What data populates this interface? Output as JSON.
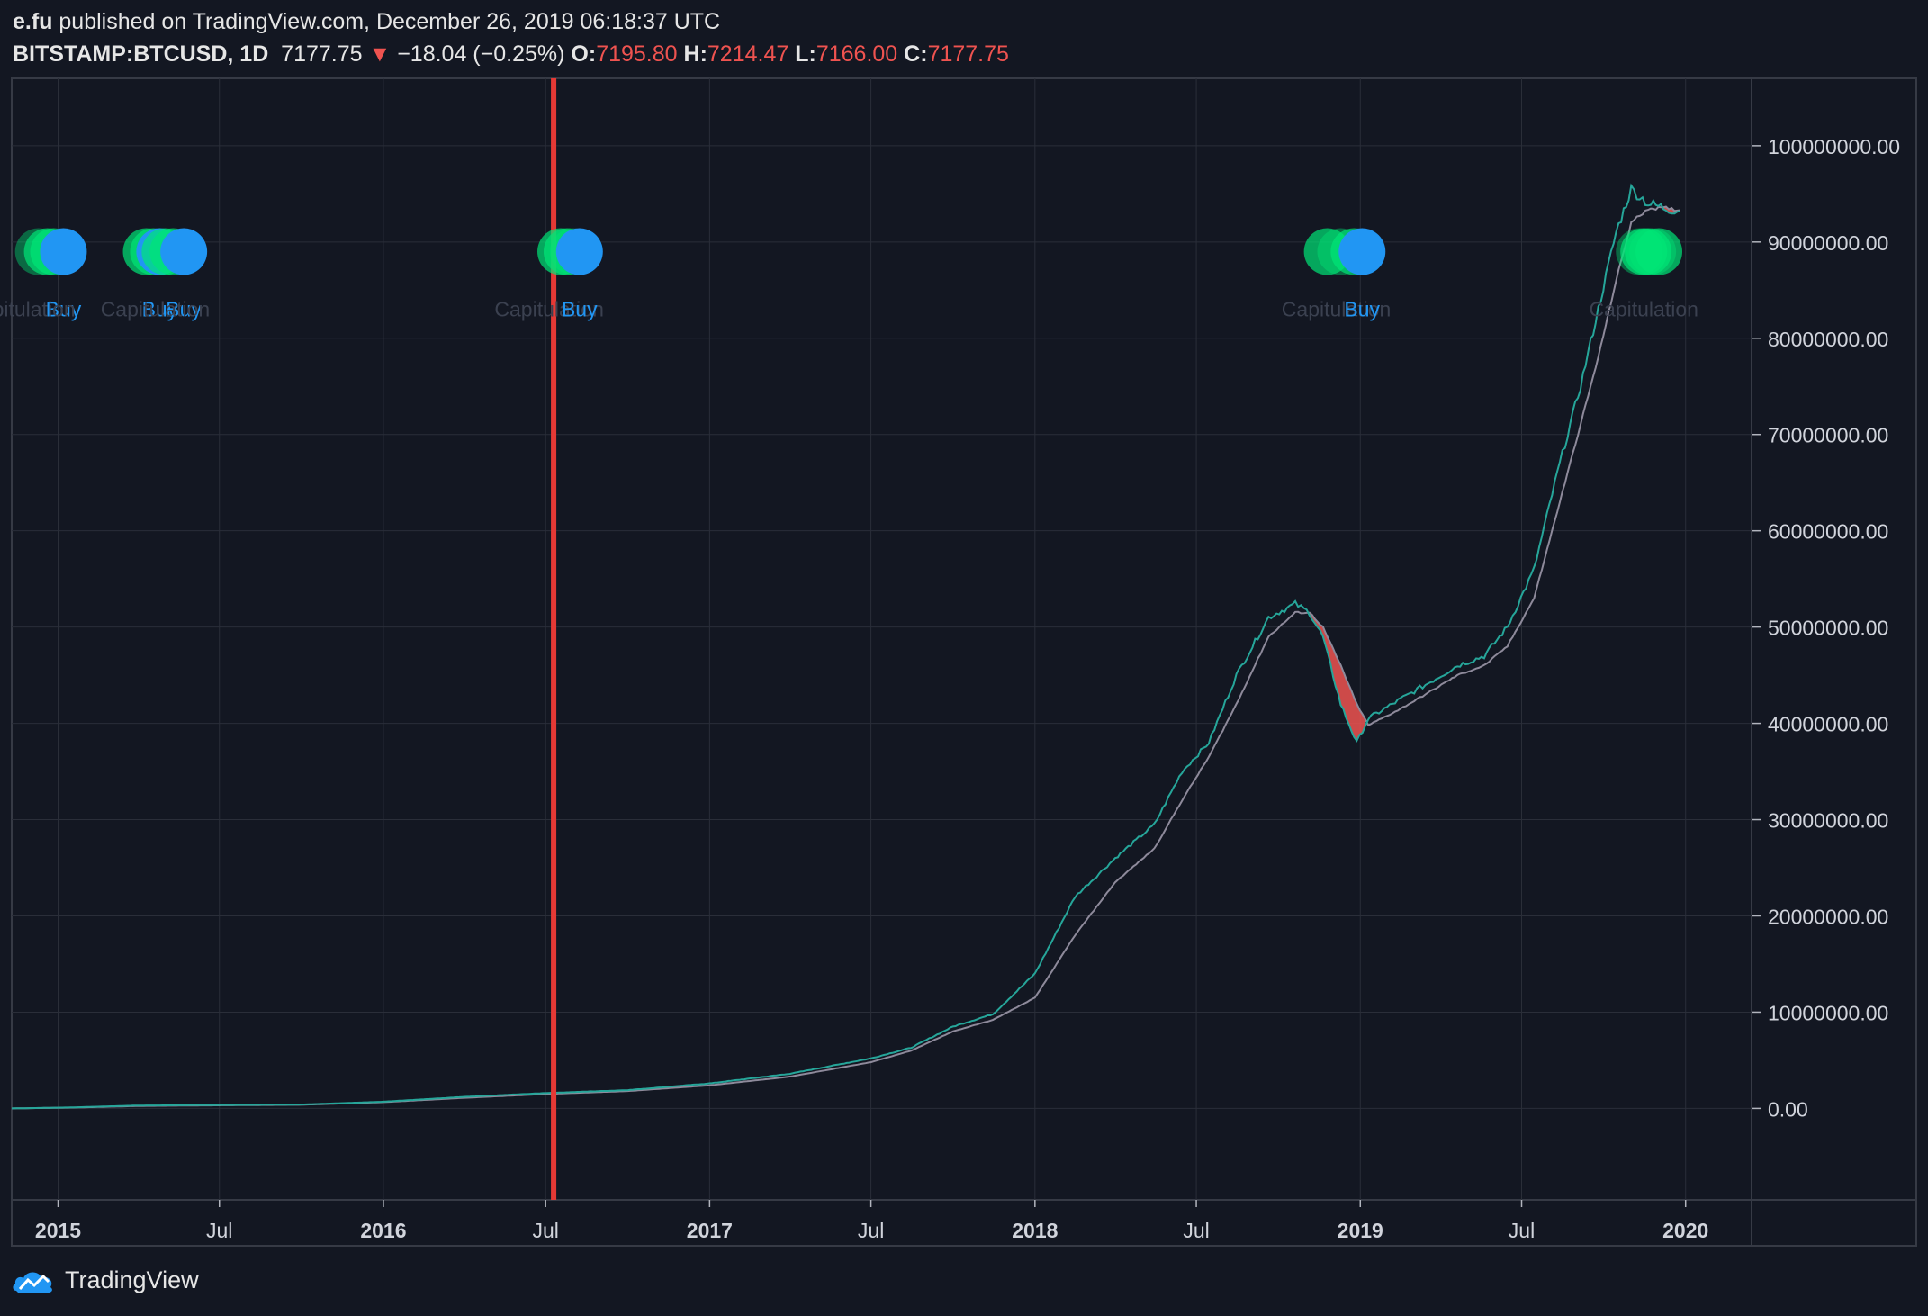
{
  "header": {
    "author": "e.fu",
    "published_text": "published on TradingView.com, December 26, 2019 06:18:37 UTC",
    "symbol": "BITSTAMP:BTCUSD, 1D",
    "last": "7177.75",
    "change_arrow": "▼",
    "change": "−18.04 (−0.25%)",
    "o_label": "O:",
    "o_value": "7195.80",
    "h_label": "H:",
    "h_value": "7214.47",
    "l_label": "L:",
    "l_value": "7166.00",
    "c_label": "C:",
    "c_value": "7177.75"
  },
  "footer": {
    "brand": "TradingView",
    "logo_icon": "tradingview-logo-icon"
  },
  "colors": {
    "background": "#131722",
    "grid": "#2a2e39",
    "line_fast": "#26a69a",
    "line_slow": "#8e8a9b",
    "fill_bear": "#ef5350",
    "buy": "#2196f3",
    "capitulation": "#00e676",
    "vline": "#e53935"
  },
  "chart_data": {
    "type": "line",
    "x_unit": "date",
    "xlim": [
      "2014-11-10",
      "2020-03-15"
    ],
    "ylim": [
      -9500000,
      107000000
    ],
    "y_ticks": [
      {
        "value": 0,
        "label": "0.00"
      },
      {
        "value": 10000000,
        "label": "10000000.00"
      },
      {
        "value": 20000000,
        "label": "20000000.00"
      },
      {
        "value": 30000000,
        "label": "30000000.00"
      },
      {
        "value": 40000000,
        "label": "40000000.00"
      },
      {
        "value": 50000000,
        "label": "50000000.00"
      },
      {
        "value": 60000000,
        "label": "60000000.00"
      },
      {
        "value": 70000000,
        "label": "70000000.00"
      },
      {
        "value": 80000000,
        "label": "80000000.00"
      },
      {
        "value": 90000000,
        "label": "90000000.00"
      },
      {
        "value": 100000000,
        "label": "100000000.00"
      }
    ],
    "x_ticks": [
      {
        "date": "2015-01-01",
        "label": "2015",
        "major": true
      },
      {
        "date": "2015-07-01",
        "label": "Jul",
        "major": false
      },
      {
        "date": "2016-01-01",
        "label": "2016",
        "major": true
      },
      {
        "date": "2016-07-01",
        "label": "Jul",
        "major": false
      },
      {
        "date": "2017-01-01",
        "label": "2017",
        "major": true
      },
      {
        "date": "2017-07-01",
        "label": "Jul",
        "major": false
      },
      {
        "date": "2018-01-01",
        "label": "2018",
        "major": true
      },
      {
        "date": "2018-07-01",
        "label": "Jul",
        "major": false
      },
      {
        "date": "2019-01-01",
        "label": "2019",
        "major": true
      },
      {
        "date": "2019-07-01",
        "label": "Jul",
        "major": false
      },
      {
        "date": "2020-01-01",
        "label": "2020",
        "major": true
      }
    ],
    "series": [
      {
        "key": "fast",
        "points": [
          [
            "2014-11-10",
            0
          ],
          [
            "2015-01-15",
            100000
          ],
          [
            "2015-04-01",
            300000
          ],
          [
            "2015-07-01",
            350000
          ],
          [
            "2015-10-01",
            400000
          ],
          [
            "2016-01-01",
            700000
          ],
          [
            "2016-04-01",
            1200000
          ],
          [
            "2016-07-01",
            1600000
          ],
          [
            "2016-10-01",
            1900000
          ],
          [
            "2017-01-01",
            2600000
          ],
          [
            "2017-04-01",
            3600000
          ],
          [
            "2017-07-01",
            5200000
          ],
          [
            "2017-08-15",
            6300000
          ],
          [
            "2017-10-01",
            8500000
          ],
          [
            "2017-11-15",
            9800000
          ],
          [
            "2018-01-01",
            14000000
          ],
          [
            "2018-02-15",
            22000000
          ],
          [
            "2018-04-01",
            26000000
          ],
          [
            "2018-05-15",
            29500000
          ],
          [
            "2018-06-15",
            35000000
          ],
          [
            "2018-07-15",
            38000000
          ],
          [
            "2018-08-15",
            45000000
          ],
          [
            "2018-09-20",
            51000000
          ],
          [
            "2018-10-20",
            52400000
          ],
          [
            "2018-11-05",
            51500000
          ],
          [
            "2018-11-20",
            49000000
          ],
          [
            "2018-12-10",
            42000000
          ],
          [
            "2018-12-28",
            38000000
          ],
          [
            "2019-01-10",
            40500000
          ],
          [
            "2019-02-15",
            42500000
          ],
          [
            "2019-03-15",
            44000000
          ],
          [
            "2019-04-20",
            46000000
          ],
          [
            "2019-05-20",
            47000000
          ],
          [
            "2019-06-15",
            50000000
          ],
          [
            "2019-07-15",
            56000000
          ],
          [
            "2019-08-10",
            66000000
          ],
          [
            "2019-09-05",
            75000000
          ],
          [
            "2019-09-25",
            83000000
          ],
          [
            "2019-10-15",
            91000000
          ],
          [
            "2019-11-01",
            95500000
          ],
          [
            "2019-11-20",
            94000000
          ],
          [
            "2019-12-10",
            93500000
          ],
          [
            "2019-12-26",
            93200000
          ]
        ]
      },
      {
        "key": "slow",
        "points": [
          [
            "2014-11-10",
            0
          ],
          [
            "2015-01-15",
            80000
          ],
          [
            "2015-04-01",
            250000
          ],
          [
            "2015-07-01",
            320000
          ],
          [
            "2015-10-01",
            380000
          ],
          [
            "2016-01-01",
            650000
          ],
          [
            "2016-04-01",
            1100000
          ],
          [
            "2016-07-01",
            1500000
          ],
          [
            "2016-10-01",
            1800000
          ],
          [
            "2017-01-01",
            2400000
          ],
          [
            "2017-04-01",
            3300000
          ],
          [
            "2017-07-01",
            4800000
          ],
          [
            "2017-08-15",
            6000000
          ],
          [
            "2017-10-01",
            8000000
          ],
          [
            "2017-11-15",
            9200000
          ],
          [
            "2018-01-01",
            11500000
          ],
          [
            "2018-02-15",
            18000000
          ],
          [
            "2018-04-01",
            23500000
          ],
          [
            "2018-05-15",
            27000000
          ],
          [
            "2018-06-15",
            32000000
          ],
          [
            "2018-07-15",
            36500000
          ],
          [
            "2018-08-15",
            42000000
          ],
          [
            "2018-09-20",
            49000000
          ],
          [
            "2018-10-20",
            51500000
          ],
          [
            "2018-11-05",
            51500000
          ],
          [
            "2018-11-20",
            50000000
          ],
          [
            "2018-12-10",
            46000000
          ],
          [
            "2018-12-28",
            42000000
          ],
          [
            "2019-01-10",
            39800000
          ],
          [
            "2019-02-15",
            41500000
          ],
          [
            "2019-03-15",
            43000000
          ],
          [
            "2019-04-20",
            45000000
          ],
          [
            "2019-05-20",
            46000000
          ],
          [
            "2019-06-15",
            48000000
          ],
          [
            "2019-07-15",
            53000000
          ],
          [
            "2019-08-10",
            62000000
          ],
          [
            "2019-09-05",
            71000000
          ],
          [
            "2019-09-25",
            78000000
          ],
          [
            "2019-10-15",
            86000000
          ],
          [
            "2019-11-01",
            92000000
          ],
          [
            "2019-11-20",
            93500000
          ],
          [
            "2019-12-10",
            93500000
          ],
          [
            "2019-12-26",
            93300000
          ]
        ]
      }
    ],
    "vertical_marker": "2016-07-10",
    "signals": [
      {
        "date": "2014-12-10",
        "type": "capitulation"
      },
      {
        "date": "2014-12-20",
        "type": "capitulation"
      },
      {
        "date": "2014-12-27",
        "type": "capitulation"
      },
      {
        "date": "2015-01-07",
        "type": "buy"
      },
      {
        "date": "2015-04-10",
        "type": "capitulation"
      },
      {
        "date": "2015-04-18",
        "type": "capitulation"
      },
      {
        "date": "2015-04-25",
        "type": "buy"
      },
      {
        "date": "2015-05-01",
        "type": "capitulation"
      },
      {
        "date": "2015-05-10",
        "type": "capitulation"
      },
      {
        "date": "2015-05-22",
        "type": "buy"
      },
      {
        "date": "2016-07-18",
        "type": "capitulation"
      },
      {
        "date": "2016-07-25",
        "type": "capitulation"
      },
      {
        "date": "2016-08-01",
        "type": "capitulation"
      },
      {
        "date": "2016-08-08",
        "type": "buy"
      },
      {
        "date": "2018-11-25",
        "type": "capitulation"
      },
      {
        "date": "2018-12-10",
        "type": "capitulation"
      },
      {
        "date": "2018-12-25",
        "type": "capitulation"
      },
      {
        "date": "2019-01-03",
        "type": "buy"
      },
      {
        "date": "2019-11-10",
        "type": "capitulation"
      },
      {
        "date": "2019-11-15",
        "type": "capitulation"
      },
      {
        "date": "2019-11-20",
        "type": "capitulation"
      },
      {
        "date": "2019-11-25",
        "type": "capitulation"
      },
      {
        "date": "2019-12-02",
        "type": "capitulation"
      }
    ],
    "signal_level": 89000000,
    "labels": [
      {
        "date": "2015-01-07",
        "text": "Buy",
        "kind": "buy"
      },
      {
        "date": "2015-04-25",
        "text": "Buy",
        "kind": "buy"
      },
      {
        "date": "2015-05-22",
        "text": "Buy",
        "kind": "buy"
      },
      {
        "date": "2014-11-20",
        "text": "Capitulation",
        "kind": "faint"
      },
      {
        "date": "2015-04-20",
        "text": "Capitulation",
        "kind": "faint"
      },
      {
        "date": "2016-07-05",
        "text": "Capitulation",
        "kind": "faint"
      },
      {
        "date": "2016-08-08",
        "text": "Buy",
        "kind": "buy"
      },
      {
        "date": "2018-12-05",
        "text": "Capitulation",
        "kind": "faint"
      },
      {
        "date": "2019-01-03",
        "text": "Buy",
        "kind": "buy"
      },
      {
        "date": "2019-11-15",
        "text": "Capitulation",
        "kind": "faint"
      }
    ],
    "label_level": 83000000
  }
}
